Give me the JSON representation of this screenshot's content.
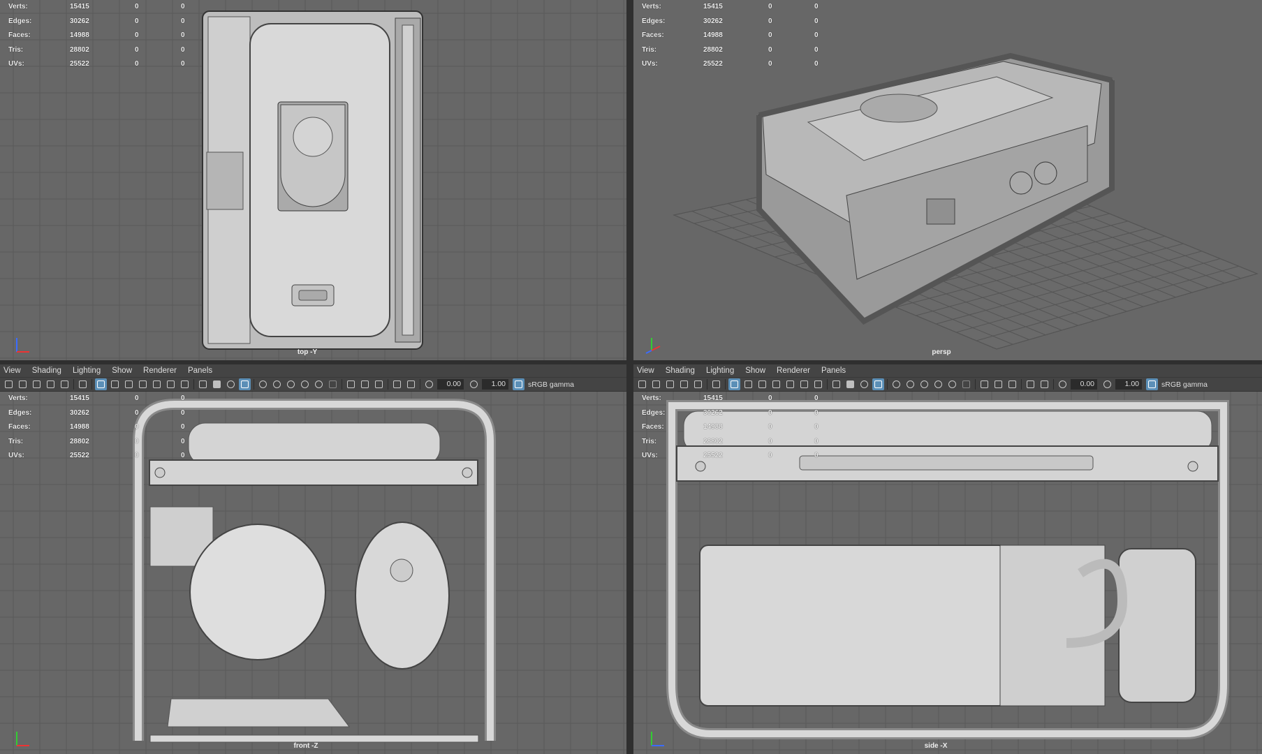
{
  "stats": {
    "labels": [
      "Verts:",
      "Edges:",
      "Faces:",
      "Tris:",
      "UVs:"
    ],
    "values": [
      "15415",
      "30262",
      "14988",
      "28802",
      "25522"
    ],
    "zero": "0"
  },
  "menu": [
    "View",
    "Shading",
    "Lighting",
    "Show",
    "Renderer",
    "Panels"
  ],
  "toolbar": {
    "field1": "0.00",
    "field2": "1.00",
    "gamma_label": "sRGB gamma"
  },
  "viewports": {
    "top_left": {
      "camera": "top -Y"
    },
    "top_right": {
      "camera": "persp"
    },
    "bottom_left": {
      "camera": "front -Z"
    },
    "bottom_right": {
      "camera": "side -X"
    }
  },
  "colors": {
    "viewport_bg": "#676767",
    "grid": "#5a5a5a",
    "panel": "#444444",
    "accent": "#5b8fb7"
  },
  "icons": [
    "select-camera-icon",
    "lock-camera-icon",
    "camera-attributes-icon",
    "bookmark-icon",
    "image-plane-icon",
    "grease-pencil-icon",
    "grid-icon",
    "film-gate-icon",
    "resolution-gate-icon",
    "gate-mask-icon",
    "field-chart-icon",
    "safe-action-icon",
    "safe-title-icon",
    "wireframe-icon",
    "smooth-shade-icon",
    "default-material-icon",
    "textured-icon",
    "use-lights-icon",
    "shadows-icon",
    "screen-space-ao-icon",
    "motion-blur-icon",
    "anti-aliasing-icon",
    "depth-of-field-icon",
    "isolate-select-icon",
    "xray-icon",
    "xray-active-icon",
    "xray-joints-icon",
    "backface-culling-icon",
    "exposure-icon",
    "gamma-icon",
    "color-management-icon"
  ]
}
